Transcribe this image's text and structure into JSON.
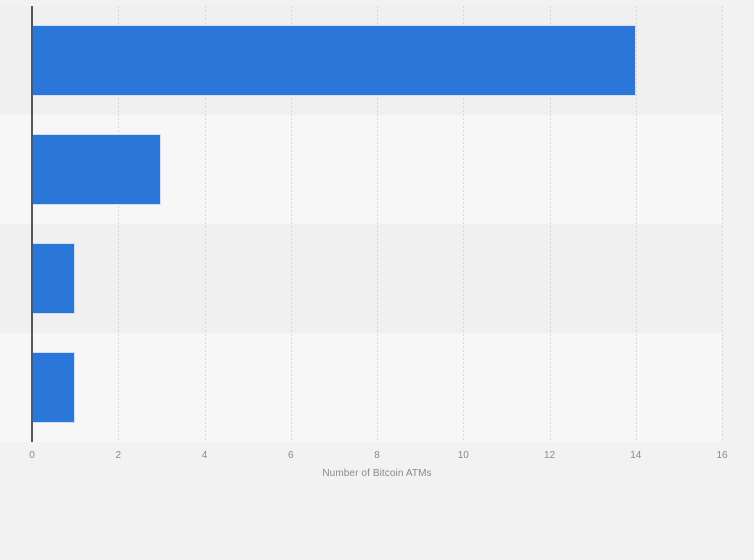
{
  "chart_data": {
    "type": "bar",
    "orientation": "horizontal",
    "title": "",
    "subtitle": "",
    "xlabel": "Number of Bitcoin ATMs",
    "ylabel": "",
    "xlim": [
      0,
      16
    ],
    "xticks": [
      0,
      2,
      4,
      6,
      8,
      10,
      12,
      14,
      16
    ],
    "xticklabels": [
      "0",
      "2",
      "4",
      "6",
      "8",
      "10",
      "12",
      "14",
      "16"
    ],
    "categories": [
      "",
      "",
      "",
      ""
    ],
    "values": [
      14,
      3,
      1,
      1
    ],
    "series": [
      {
        "name": "Number of Bitcoin ATMs",
        "values": [
          14,
          3,
          1,
          1
        ]
      }
    ],
    "grid": {
      "vertical": true,
      "horizontal": false,
      "style": "dotted",
      "color": "#d8d8d8"
    },
    "legend": {
      "visible": false,
      "position": "none",
      "entries": []
    },
    "annotations": [],
    "colors": {
      "bar": "#2b77d9",
      "bar_edge": "#cfdff5",
      "background": "#f2f2f2",
      "band_dark": "#f0f0f0",
      "band_light": "#f7f7f7",
      "axis_line": "#575757",
      "tick_label": "#8a8a8a",
      "axis_title": "#8a8a8a"
    }
  }
}
